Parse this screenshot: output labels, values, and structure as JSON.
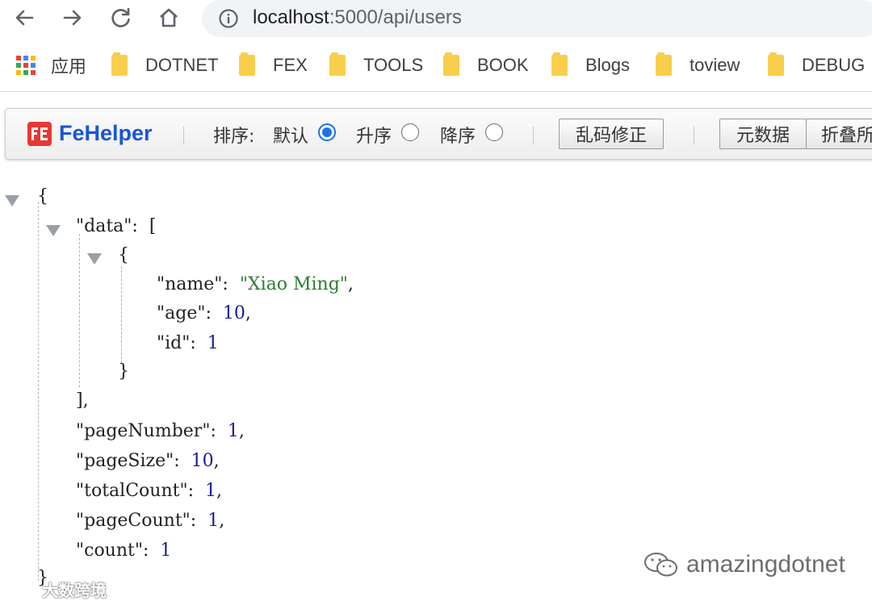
{
  "browser": {
    "url_host": "localhost",
    "url_path": ":5000/api/users",
    "bookmarks": [
      {
        "label": "应用",
        "icon": "apps-grid-icon"
      },
      {
        "label": "DOTNET",
        "icon": "folder-icon"
      },
      {
        "label": "FEX",
        "icon": "folder-icon"
      },
      {
        "label": "TOOLS",
        "icon": "folder-icon"
      },
      {
        "label": "BOOK",
        "icon": "folder-icon"
      },
      {
        "label": "Blogs",
        "icon": "folder-icon"
      },
      {
        "label": "toview",
        "icon": "folder-icon"
      },
      {
        "label": "DEBUG",
        "icon": "folder-icon"
      }
    ]
  },
  "fehelper": {
    "brand": "FeHelper",
    "sort_label": "排序:",
    "sort_options": [
      {
        "label": "默认",
        "checked": true
      },
      {
        "label": "升序",
        "checked": false
      },
      {
        "label": "降序",
        "checked": false
      }
    ],
    "buttons": [
      "乱码修正",
      "元数据",
      "折叠所"
    ],
    "accent_color": "#1a55d8"
  },
  "json": {
    "open_brace": "{",
    "data_key": "\"data\"",
    "open_bracket": "[",
    "item_open": "{",
    "item": [
      {
        "key": "\"name\"",
        "value": "\"Xiao Ming\"",
        "type": "string",
        "comma": ","
      },
      {
        "key": "\"age\"",
        "value": "10",
        "type": "number",
        "comma": ","
      },
      {
        "key": "\"id\"",
        "value": "1",
        "type": "number",
        "comma": ""
      }
    ],
    "item_close": "}",
    "close_bracket": "],",
    "fields": [
      {
        "key": "\"pageNumber\"",
        "value": "1",
        "comma": ","
      },
      {
        "key": "\"pageSize\"",
        "value": "10",
        "comma": ","
      },
      {
        "key": "\"totalCount\"",
        "value": "1",
        "comma": ","
      },
      {
        "key": "\"pageCount\"",
        "value": "1",
        "comma": ","
      },
      {
        "key": "\"count\"",
        "value": "1",
        "comma": ""
      }
    ],
    "close_brace": "}",
    "string_color": "#2e7d32",
    "number_color": "#1a1a9c"
  },
  "watermarks": {
    "right": "amazingdotnet",
    "left": "大数跨境"
  }
}
